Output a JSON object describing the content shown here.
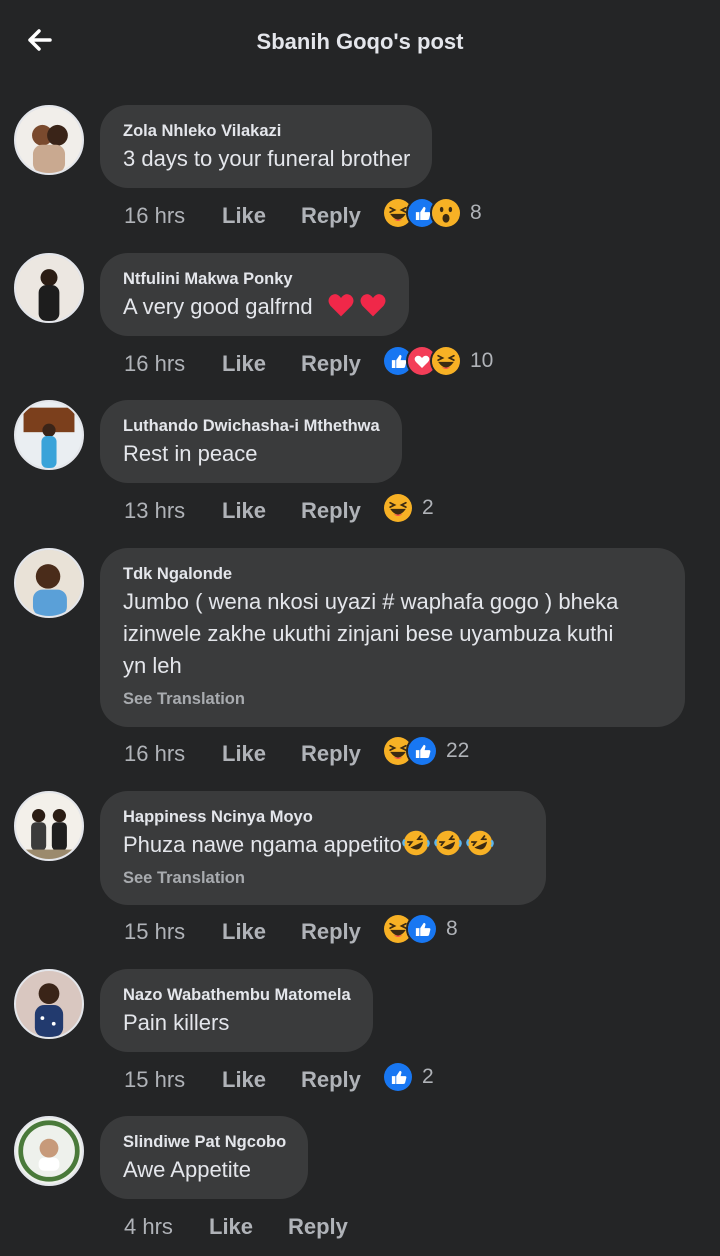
{
  "header": {
    "title": "Sbanih Goqo's post",
    "back_icon": "arrow-left-icon"
  },
  "labels": {
    "like": "Like",
    "reply": "Reply",
    "see_translation": "See Translation"
  },
  "colors": {
    "background": "#242526",
    "bubble": "#3a3b3c",
    "like_blue": "#1877f2",
    "love_red": "#f33e58",
    "haha_yellow": "#f7b125"
  },
  "comments": [
    {
      "author": "Zola Nhleko Vilakazi",
      "text": "3 days to your funeral brother",
      "time": "16 hrs",
      "reactions": [
        "haha",
        "like",
        "wow"
      ],
      "count": "8"
    },
    {
      "author": "Ntfulini Makwa Ponky",
      "text": "A very good galfrnd",
      "text_emojis": [
        "heart",
        "heart"
      ],
      "time": "16 hrs",
      "reactions": [
        "like",
        "love",
        "haha"
      ],
      "count": "10"
    },
    {
      "author": "Luthando Dwichasha-i Mthethwa",
      "text": "Rest in peace",
      "time": "13 hrs",
      "reactions": [
        "haha"
      ],
      "count": "2"
    },
    {
      "author": "Tdk Ngalonde",
      "text_lines": [
        "Jumbo ( wena nkosi uyazi # waphafa gogo ) bheka",
        "izinwele zakhe ukuthi zinjani bese uyambuza kuthi",
        "yn leh"
      ],
      "see_translation": true,
      "time": "16 hrs",
      "reactions": [
        "haha",
        "like"
      ],
      "count": "22"
    },
    {
      "author": "Happiness Ncinya Moyo",
      "text": "Phuza nawe ngama appetito",
      "text_emojis": [
        "rofl",
        "rofl",
        "rofl"
      ],
      "see_translation": true,
      "time": "15 hrs",
      "reactions": [
        "haha",
        "like"
      ],
      "count": "8"
    },
    {
      "author": "Nazo Wabathembu Matomela",
      "text": "Pain killers",
      "time": "15 hrs",
      "reactions": [
        "like"
      ],
      "count": "2"
    },
    {
      "author": "Slindiwe Pat Ngcobo",
      "text": "Awe Appetite",
      "time": "4 hrs",
      "reactions": [],
      "count": ""
    }
  ]
}
